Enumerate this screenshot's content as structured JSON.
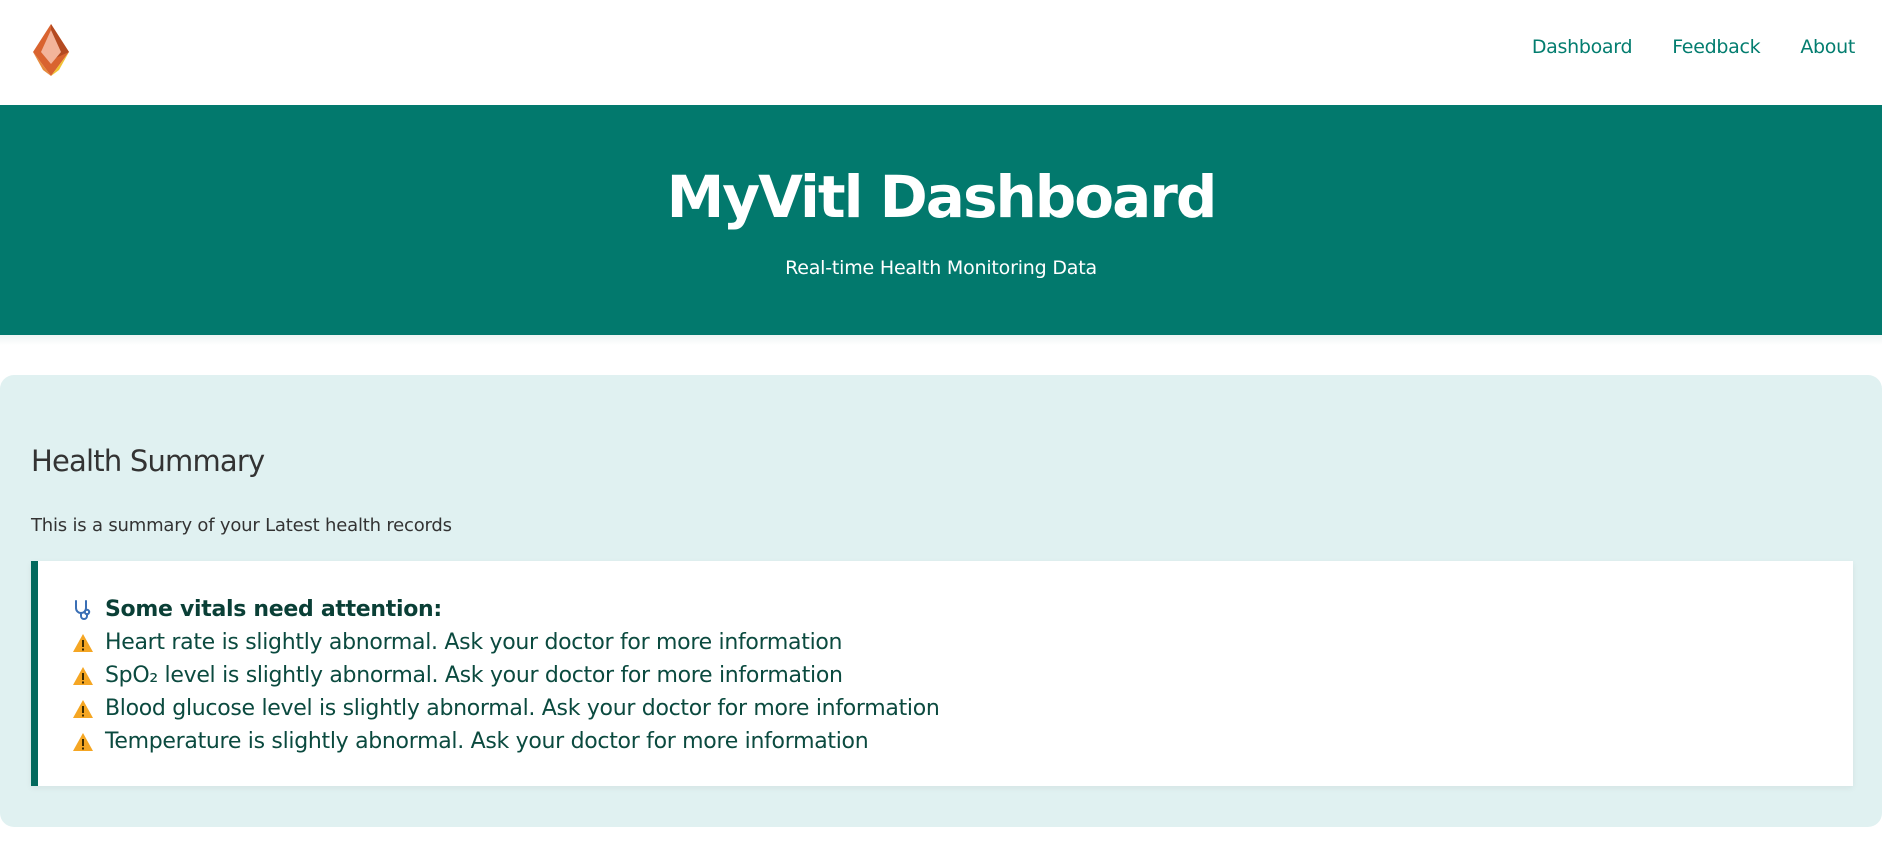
{
  "nav": {
    "logo": "logo",
    "links": [
      "Dashboard",
      "Feedback",
      "About"
    ]
  },
  "hero": {
    "title": "MyVitl Dashboard",
    "subtitle": "Real-time Health Monitoring Data"
  },
  "summary": {
    "title": "Health Summary",
    "description": "This is a summary of your Latest health records",
    "alert": {
      "heading_icon": "stethoscope-icon",
      "heading": "Some vitals need attention:",
      "item_icon": "warning-icon",
      "items": [
        "Heart rate is slightly abnormal. Ask your doctor for more information",
        "SpO₂ level is slightly abnormal. Ask your doctor for more information",
        "Blood glucose level is slightly abnormal. Ask your doctor for more information",
        "Temperature is slightly abnormal. Ask your doctor for more information"
      ]
    }
  },
  "colors": {
    "primary": "#02796d",
    "nav_link": "#037d6f",
    "summary_bg": "#e0f1f1",
    "alert_border": "#03695d",
    "warning": "#f5a623"
  }
}
